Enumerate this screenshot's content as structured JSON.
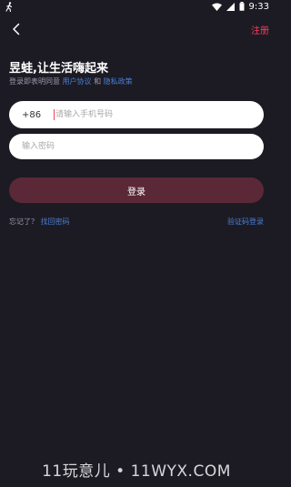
{
  "status_bar": {
    "time": "9:33",
    "left_icon": "walking-figure-icon",
    "icons": [
      "wifi-icon",
      "signal-icon",
      "battery-icon"
    ]
  },
  "nav": {
    "back_icon": "chevron-left-icon",
    "register_label": "注册"
  },
  "headline": "昱蛙,让生活嗨起来",
  "agreement": {
    "prefix": "登录即表明同意",
    "user_agreement": "用户协议",
    "and": "和",
    "privacy_policy": "隐私政策"
  },
  "phone": {
    "country_code": "+86",
    "placeholder": "请输入手机号码",
    "value": ""
  },
  "password": {
    "placeholder": "输入密码",
    "value": ""
  },
  "login_label": "登录",
  "forgot": {
    "question": "忘记了？",
    "find_password": "找回密码"
  },
  "sms_login_label": "验证码登录",
  "watermark": "11玩意儿 • 11WYX.COM",
  "colors": {
    "background": "#1c1b24",
    "accent": "#ff3b5c",
    "link": "#4a7fd6",
    "login_button": "#5b2837"
  }
}
